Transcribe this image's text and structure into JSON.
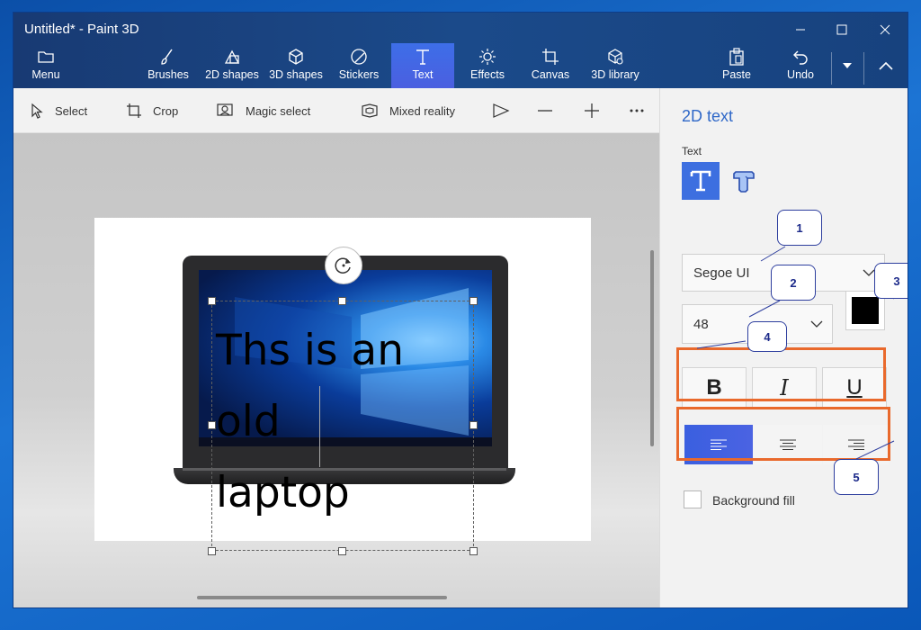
{
  "window": {
    "title": "Untitled* - Paint 3D"
  },
  "ribbon": {
    "menu": "Menu",
    "tools": [
      {
        "label": "Brushes"
      },
      {
        "label": "2D shapes"
      },
      {
        "label": "3D shapes"
      },
      {
        "label": "Stickers"
      },
      {
        "label": "Text"
      },
      {
        "label": "Effects"
      },
      {
        "label": "Canvas"
      },
      {
        "label": "3D library"
      }
    ],
    "paste": "Paste",
    "undo": "Undo",
    "active_tool": "Text"
  },
  "subtoolbar": {
    "select": "Select",
    "crop": "Crop",
    "magic_select": "Magic select",
    "mixed_reality": "Mixed reality"
  },
  "canvas": {
    "text_lines": [
      "Ths is an",
      "old",
      "laptop"
    ]
  },
  "panel": {
    "title": "2D text",
    "text_label": "Text",
    "font": "Segoe UI",
    "size": "48",
    "text_color": "#000000",
    "bold": "B",
    "italic": "I",
    "underline": "U",
    "alignment": "left",
    "background_fill": "Background fill"
  },
  "callouts": [
    "1",
    "2",
    "3",
    "4",
    "5"
  ],
  "colors": {
    "accent": "#3d6fe0",
    "title_bar": "#183a73",
    "highlight": "#e9692c",
    "callout_text": "#1c2a8a"
  }
}
